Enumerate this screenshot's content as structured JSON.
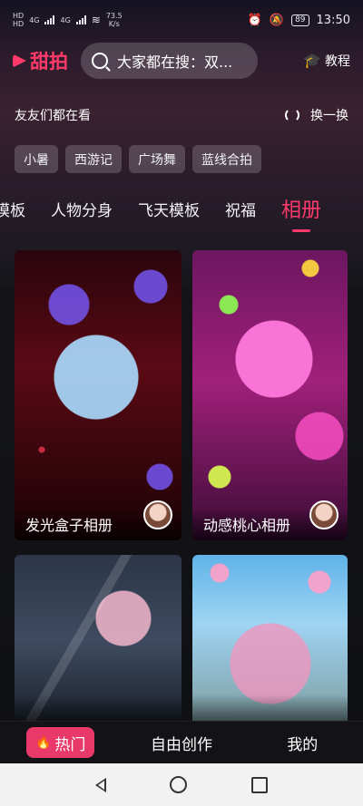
{
  "status_bar": {
    "hd1": "HD",
    "hd2": "HD",
    "net1": "4G",
    "net2": "4G",
    "speed": "73.5",
    "speed_unit": "K/s",
    "battery": "89",
    "time": "13:50",
    "icons": [
      "signal-icon",
      "wifi-icon",
      "alarm-icon",
      "mute-icon",
      "battery-icon"
    ]
  },
  "header": {
    "app_name": "甜拍",
    "search_placeholder": "大家都在搜：双...",
    "tutorial_label": "教程",
    "accent": "#ff3a6b"
  },
  "trending": {
    "title": "友友们都在看",
    "refresh_label": "换一换",
    "chips": [
      "小暑",
      "西游记",
      "广场舞",
      "蓝线合拍"
    ]
  },
  "category_tabs": {
    "items": [
      "模板",
      "人物分身",
      "飞天模板",
      "祝福",
      "相册"
    ],
    "active_index": 4
  },
  "cards": [
    {
      "title": "发光盒子相册"
    },
    {
      "title": "动感桃心相册"
    },
    {
      "title": ""
    },
    {
      "title": ""
    }
  ],
  "bottom_nav": {
    "items": [
      "热门",
      "自由创作",
      "我的"
    ],
    "active_index": 0,
    "active_color": "#e9396b"
  }
}
